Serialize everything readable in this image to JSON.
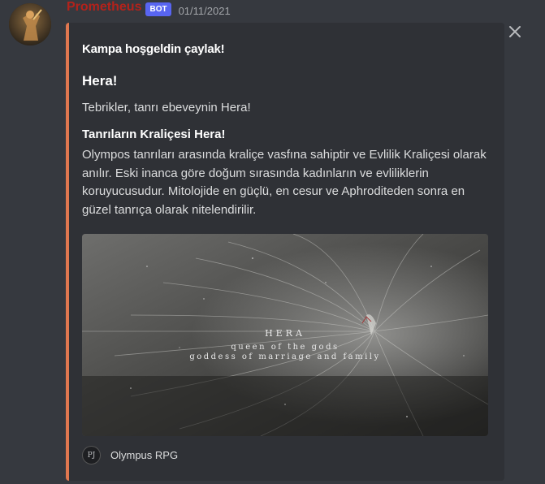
{
  "message": {
    "username": "Prometheus",
    "bot_tag": "BOT",
    "timestamp": "01/11/2021"
  },
  "embed": {
    "accent_color": "#e0774f",
    "author": "Kampa hoşgeldin çaylak!",
    "title": "Hera!",
    "description": "Tebrikler, tanrı ebeveynin Hera!",
    "field": {
      "name": "Tanrıların Kraliçesi Hera!",
      "value": "Olympos tanrıları arasında kraliçe vasfına sahiptir ve Evlilik Kraliçesi olarak anılır. Eski inanca göre doğum sırasında kadınların ve evliliklerin koruyucusudur. Mitolojide en güçlü, en cesur ve Aphroditeden sonra en güzel tanrıça olarak nitelendirilir."
    },
    "image": {
      "title": "HERA",
      "line1": "queen of the gods",
      "line2": "goddess of marriage and family"
    },
    "footer": {
      "icon_text": "PJ",
      "text": "Olympus RPG"
    }
  },
  "icons": {
    "close": "close-icon",
    "avatar": "avatar"
  }
}
